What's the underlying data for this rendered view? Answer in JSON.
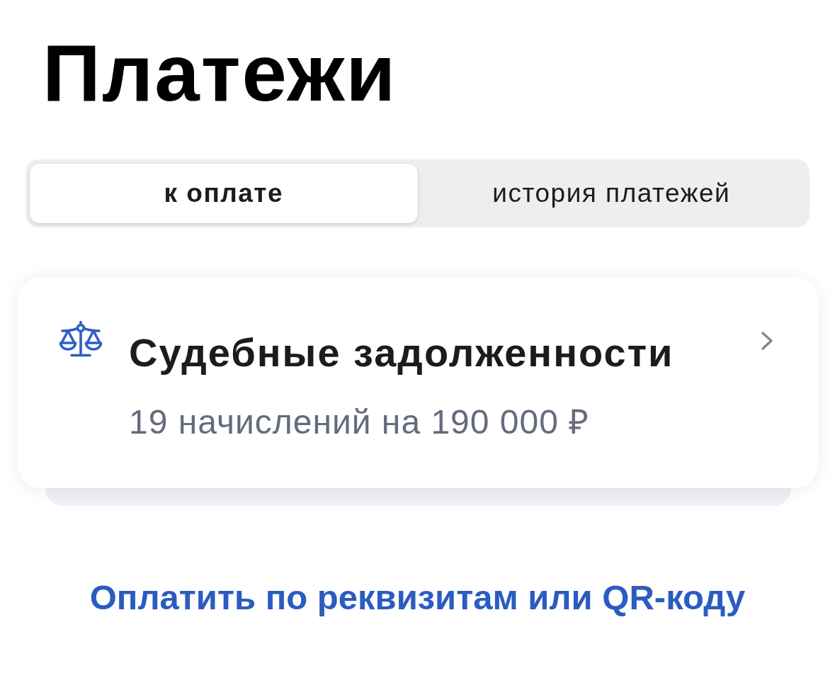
{
  "header": {
    "title": "Платежи"
  },
  "tabs": [
    {
      "label": "к оплате",
      "selected": true
    },
    {
      "label": "история платежей",
      "selected": false
    }
  ],
  "cards": [
    {
      "title": "Судебные задолженности",
      "subtitle": "19 начислений на 190 000 ₽"
    }
  ],
  "link": {
    "label": "Оплатить по реквизитам или QR-коду"
  }
}
